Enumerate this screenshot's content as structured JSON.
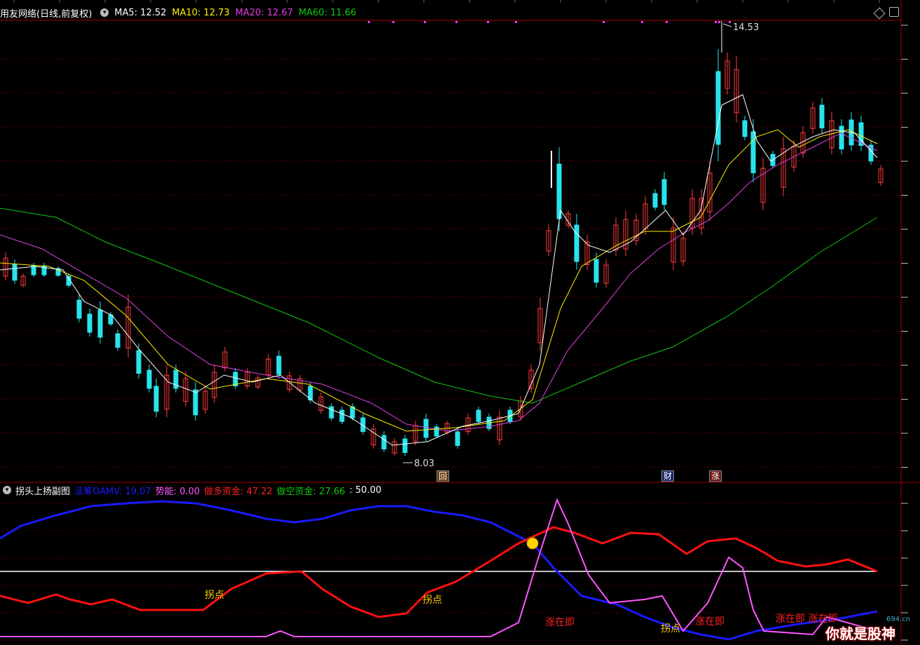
{
  "header": {
    "stock_title": "用友网络(日线,前复权)",
    "ma5": "MA5: 12.52",
    "ma10": "MA10: 12.73",
    "ma20": "MA20: 12.67",
    "ma60": "MA60: 11.66"
  },
  "main_chart": {
    "high_label": "14.53",
    "low_label": "8.03",
    "badges": [
      "回",
      "财",
      "涨"
    ],
    "colors": {
      "up": "#ff3b3b",
      "down": "#29e3ec",
      "ma5": "#ffffff",
      "ma10": "#ffee00",
      "ma20": "#e040e0",
      "ma60": "#10c810",
      "grid": "#a00000"
    }
  },
  "sub_chart": {
    "title": "拐头上扬副图",
    "oamv": "活筹OAMV: 19.07",
    "shineng": "势能: 0.00",
    "zuoduo": "做多资金: 47.22",
    "zuokong": "做空资金: 27.66",
    "level": ": 50.00",
    "annotations": {
      "guaidian1": "拐点",
      "guaidian2": "拐点",
      "guaidian3": "拐点",
      "zhangzaiji1": "涨在即",
      "zhangzaiji2": "涨在即",
      "zhangzaiji3": "涨在即 涨在即"
    },
    "colors": {
      "blue": "#1a1aff",
      "red": "#ff1010",
      "pink": "#ff55ff",
      "white": "#ffffff",
      "yellow": "#ffcc00"
    }
  },
  "watermark": {
    "text": "你就是股神",
    "url": "694.cn"
  }
}
